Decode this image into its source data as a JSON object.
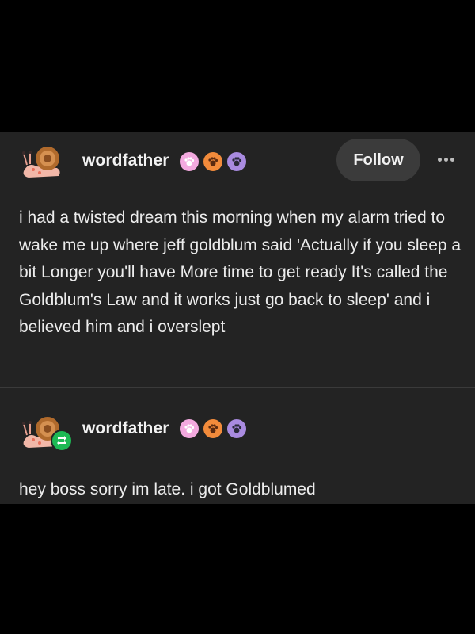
{
  "post": {
    "author": "wordfather",
    "follow_label": "Follow",
    "text": "i had a twisted dream this morning when my alarm tried to wake me up where jeff goldblum said 'Actually if you sleep a bit Longer you'll have More time to get ready It's called the Goldblum's Law and it works just go back to sleep' and i believed him and i overslept",
    "badges": [
      "pink-paw-badge-icon",
      "orange-paw-badge-icon",
      "purple-paw-badge-icon"
    ]
  },
  "reblog": {
    "author": "wordfather",
    "text": "hey boss sorry im late. i got Goldblumed",
    "badges": [
      "pink-paw-badge-icon",
      "orange-paw-badge-icon",
      "purple-paw-badge-icon"
    ]
  },
  "colors": {
    "background": "#000000",
    "card": "#232323",
    "follow_button": "#3b3b3b",
    "reblog_green": "#1db954",
    "badge_pink": "#f3a9df",
    "badge_orange": "#f28b3b",
    "badge_purple": "#a98be0"
  }
}
